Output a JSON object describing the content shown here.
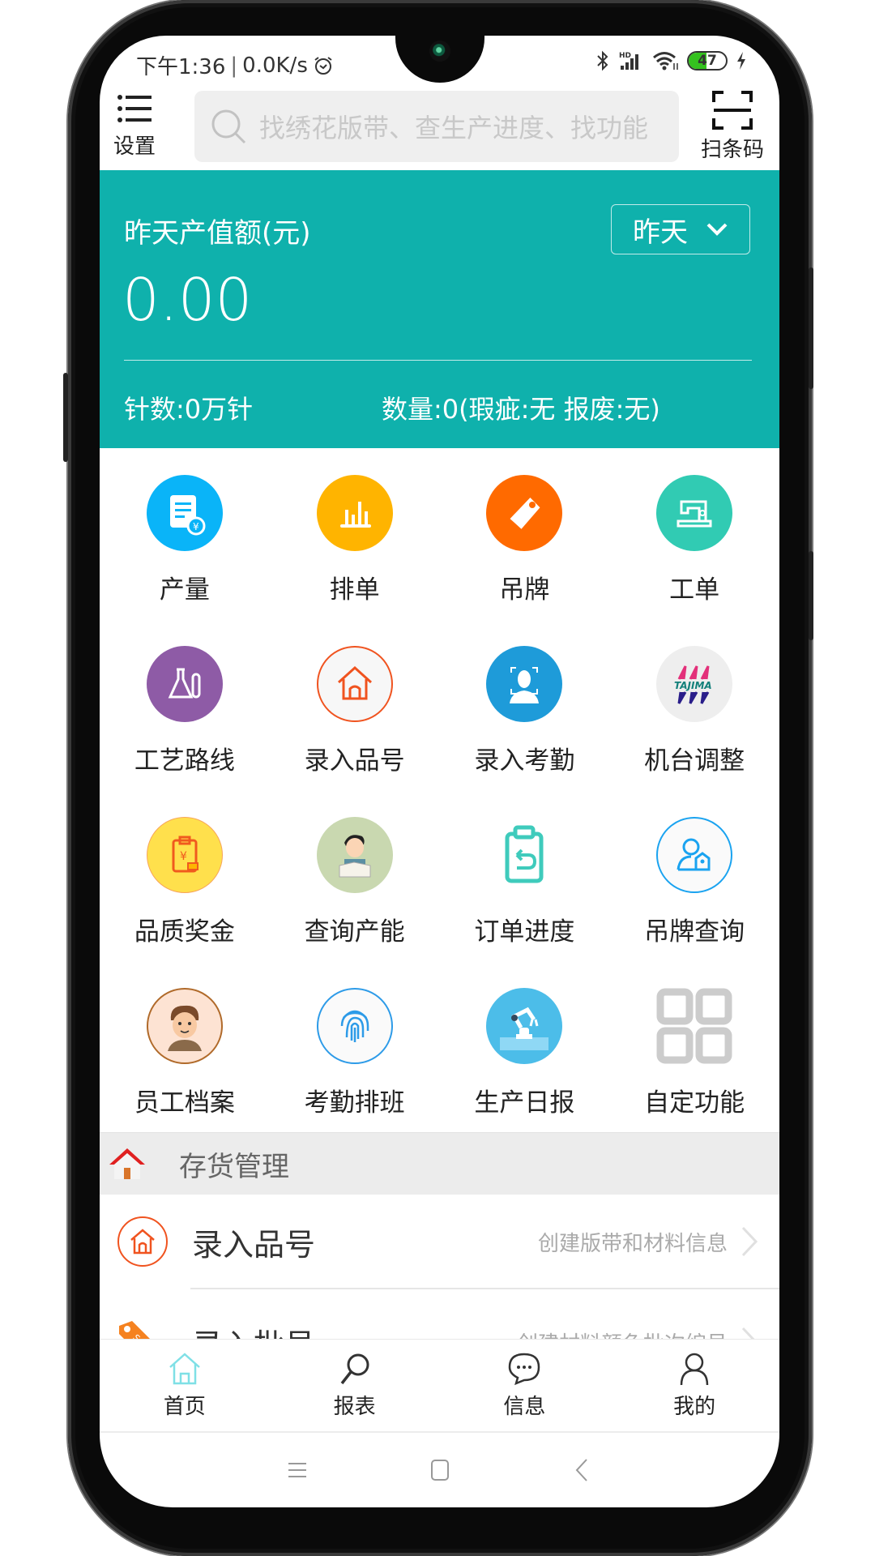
{
  "status_bar": {
    "time": "下午1:36",
    "separator": "|",
    "network_speed": "0.0K/s",
    "battery_level": "47",
    "battery_fraction": 0.47,
    "icons": [
      "alarm-icon",
      "bluetooth-icon",
      "hd-signal-icon",
      "wifi-icon",
      "battery-icon",
      "charging-icon"
    ]
  },
  "header": {
    "settings_label": "设置",
    "search_placeholder": "找绣花版带、查生产进度、找功能",
    "scan_label": "扫条码"
  },
  "summary": {
    "title": "昨天产值额(元)",
    "period_selected": "昨天",
    "value": "0.00",
    "stitch_count": "针数:0万针",
    "quantity": "数量:0(瑕疵:无 报废:无)",
    "background_color": "#0fb1ac"
  },
  "grid": [
    {
      "label": "产量",
      "icon": "production-doc-icon",
      "color": "#0ab4f8"
    },
    {
      "label": "排单",
      "icon": "bar-chart-icon",
      "color": "#ffb400"
    },
    {
      "label": "吊牌",
      "icon": "tag-icon",
      "color": "#ff6a00"
    },
    {
      "label": "工单",
      "icon": "sewing-machine-icon",
      "color": "#31cbb3"
    },
    {
      "label": "工艺路线",
      "icon": "lab-flask-icon",
      "color": "#8e5ba6"
    },
    {
      "label": "录入品号",
      "icon": "house-outline-icon",
      "color": "#f0531f"
    },
    {
      "label": "录入考勤",
      "icon": "face-scan-person-icon",
      "color": "#1e9bd9"
    },
    {
      "label": "机台调整",
      "icon": "tajima-logo-icon",
      "color": "#eeeeee"
    },
    {
      "label": "品质奖金",
      "icon": "bonus-clipboard-icon",
      "color": "#ffe04c"
    },
    {
      "label": "查询产能",
      "icon": "student-writing-icon",
      "color": "#c9d8b0"
    },
    {
      "label": "订单进度",
      "icon": "clipboard-return-icon",
      "color": "#3fcbbc"
    },
    {
      "label": "吊牌查询",
      "icon": "user-tag-icon",
      "color": "#1aa3f0"
    },
    {
      "label": "员工档案",
      "icon": "employee-avatar-icon",
      "color": "#fde3d3"
    },
    {
      "label": "考勤排班",
      "icon": "fingerprint-icon",
      "color": "#2d9be8"
    },
    {
      "label": "生产日报",
      "icon": "robot-arm-icon",
      "color": "#4cbde9"
    },
    {
      "label": "自定功能",
      "icon": "custom-grid-icon",
      "color": "#cccccc"
    }
  ],
  "section": {
    "title": "存货管理"
  },
  "list": [
    {
      "title": "录入品号",
      "desc": "创建版带和材料信息"
    },
    {
      "title": "录入批号",
      "desc": "创建材料颜色批次编号"
    }
  ],
  "tabs": [
    {
      "label": "首页",
      "active": true
    },
    {
      "label": "报表",
      "active": false
    },
    {
      "label": "信息",
      "active": false
    },
    {
      "label": "我的",
      "active": false
    }
  ]
}
